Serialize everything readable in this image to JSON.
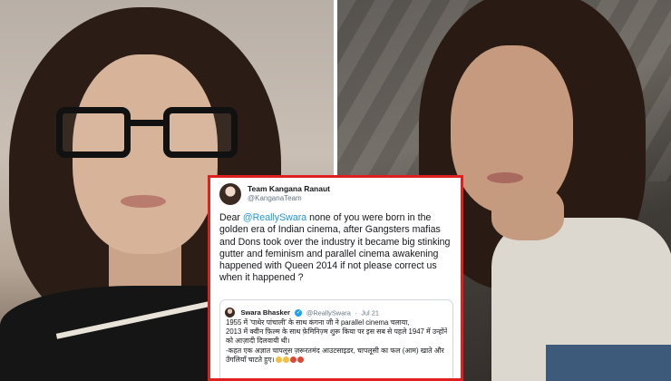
{
  "tweet": {
    "author_name": "Team Kangana Ranaut",
    "author_handle": "@KanganaTeam",
    "body_prefix": "Dear ",
    "body_mention": "@ReallySwara",
    "body_rest": " none of you were born in the golden era of Indian cinema, after Gangsters mafias and Dons took over the industry it became big stinking gutter and feminism and parallel cinema awakening happened with Queen 2014 if not please correct us when it happened ?",
    "quoted": {
      "name": "Swara Bhasker",
      "verified_symbol": "✓",
      "handle": "@ReallySwara",
      "separator": "·",
      "date": "Jul 21",
      "lines": [
        "1955 में 'पाथेर पांचाली' के साथ कंगना जी ने parallel cinema चलाया,",
        "2013 में क्वीन फ़िल्म के साथ फ़ेमिनिज़्म शुरू किया पर इस सब से पहले 1947 में उन्होंने भारत",
        "को आज़ादी दिलवायी थी।",
        "-कहत एक अज्ञात चापलूस ज़रूरतमंद आउटसाइडर, चापलूसी का फल (आम) खाते और",
        "उँगलियाँ चाटते हुए।"
      ]
    }
  },
  "colors": {
    "border_highlight": "#e01f1f",
    "mention_blue": "#1b95e0",
    "verified_blue": "#1da1f2"
  }
}
